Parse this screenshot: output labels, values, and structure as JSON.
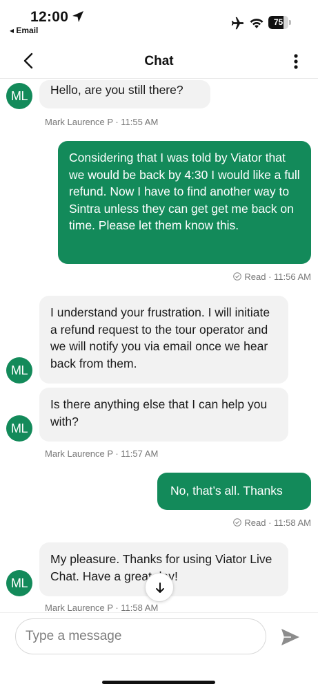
{
  "status_bar": {
    "time": "12:00",
    "back_app": "◂ Email",
    "battery_percent": 75,
    "battery_label": "75"
  },
  "header": {
    "title": "Chat",
    "back_icon": "chevron-left-icon",
    "more_icon": "more-vertical-icon"
  },
  "messages": [
    {
      "from": "agent",
      "avatar": "ML",
      "text": "Hello, are you still there?",
      "meta": "Mark Laurence P · 11:55 AM"
    },
    {
      "from": "user",
      "text": "Considering that I was told by Viator that we would be back by 4:30 I would like a full refund. Now I have to find another way to Sintra unless they can get get me back on time. Please let them know this.",
      "meta": "Read · 11:56 AM"
    },
    {
      "from": "agent",
      "avatar": "ML",
      "text": "I understand your frustration. I will initiate a refund request to the tour operator and we will notify you via email once we hear back from them."
    },
    {
      "from": "agent",
      "avatar": "ML",
      "text": "Is there anything else that I can help you with?",
      "meta": "Mark Laurence P · 11:57 AM"
    },
    {
      "from": "user",
      "text": "No, that’s all. Thanks",
      "meta": "Read · 11:58 AM"
    },
    {
      "from": "agent",
      "avatar": "ML",
      "text": "My pleasure. Thanks for using Viator Live Chat. Have a great day!",
      "meta": "Mark Laurence P · 11:58 AM"
    }
  ],
  "composer": {
    "placeholder": "Type a message",
    "value": ""
  },
  "colors": {
    "accent": "#138a5a",
    "incoming_bubble": "#f2f2f2",
    "meta_text": "#767676"
  }
}
